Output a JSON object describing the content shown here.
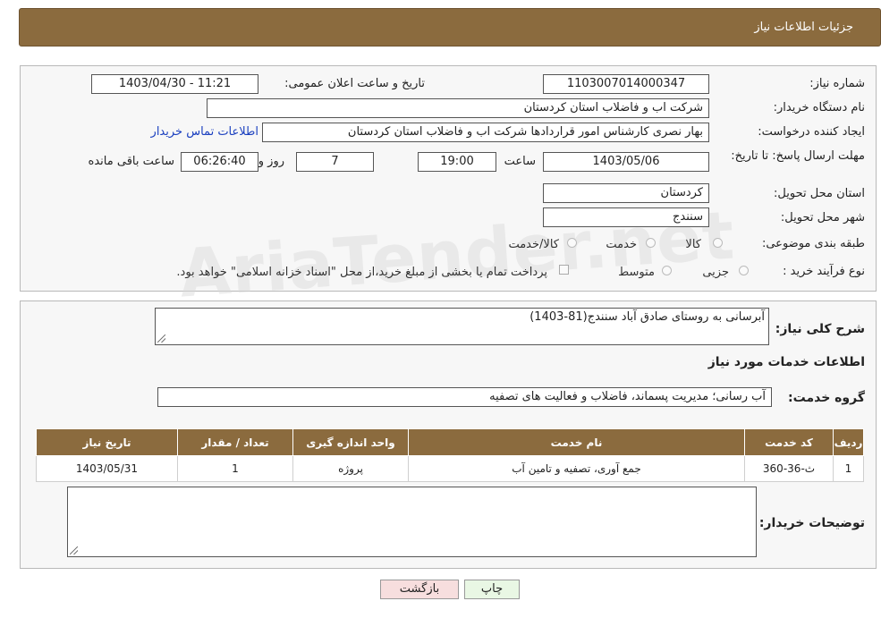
{
  "header": {
    "title": "جزئیات اطلاعات نیاز"
  },
  "form": {
    "need_number_label": "شماره نیاز:",
    "need_number": "1103007014000347",
    "announce_label": "تاریخ و ساعت اعلان عمومی:",
    "announce_value": "1403/04/30 - 11:21",
    "buyer_org_label": "نام دستگاه خریدار:",
    "buyer_org": "شرکت اب و فاضلاب استان کردستان",
    "creator_label": "ایجاد کننده درخواست:",
    "creator": "بهار نصری کارشناس امور قراردادها شرکت اب و فاضلاب استان کردستان",
    "contact_link": "اطلاعات تماس خریدار",
    "deadline_label": "مهلت ارسال پاسخ: تا تاریخ:",
    "deadline_date": "1403/05/06",
    "time_label": "ساعت",
    "deadline_time": "19:00",
    "days": "7",
    "days_label": "روز و",
    "remaining": "06:26:40",
    "remaining_label": "ساعت باقی مانده",
    "province_label": "استان محل تحویل:",
    "province": "کردستان",
    "city_label": "شهر محل تحویل:",
    "city": "سنندج",
    "category_label": "طبقه بندی موضوعی:",
    "category_options": [
      "کالا",
      "خدمت",
      "کالا/خدمت"
    ],
    "process_label": "نوع فرآیند خرید :",
    "process_options": [
      "جزیی",
      "متوسط"
    ],
    "payment_note": "پرداخت تمام یا بخشی از مبلغ خرید،از محل \"اسناد خزانه اسلامی\" خواهد بود."
  },
  "details": {
    "summary_label": "شرح کلی نیاز:",
    "summary": "آبرسانی به روستای صادق آباد سنندج(81-1403)",
    "services_title": "اطلاعات خدمات مورد نیاز",
    "service_group_label": "گروه خدمت:",
    "service_group": "آب رسانی؛ مدیریت پسماند، فاضلاب و فعالیت های تصفیه",
    "table": {
      "headers": [
        "ردیف",
        "کد خدمت",
        "نام خدمت",
        "واحد اندازه گیری",
        "تعداد / مقدار",
        "تاریخ نیاز"
      ],
      "rows": [
        [
          "1",
          "ث-36-360",
          "جمع آوری، تصفیه و تامین آب",
          "پروژه",
          "1",
          "1403/05/31"
        ]
      ]
    },
    "buyer_notes_label": "توضیحات خریدار:",
    "buyer_notes": ""
  },
  "buttons": {
    "print": "چاپ",
    "back": "بازگشت"
  },
  "watermark": "AriaTender.net",
  "colors": {
    "header": "#8b6b3e",
    "link": "#1a3fbf",
    "back_button": "#f7dede",
    "print_button": "#e9f7e4"
  }
}
